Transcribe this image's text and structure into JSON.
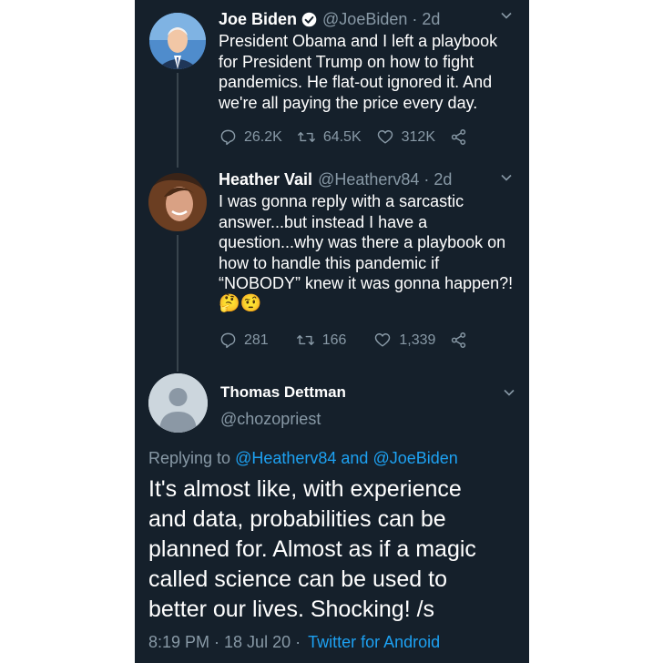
{
  "tweets": [
    {
      "name": "Joe Biden",
      "handle": "@JoeBiden",
      "time": "· 2d",
      "lines": [
        "President Obama and I left a playbook",
        "for President Trump on how to fight",
        "pandemics. He flat-out ignored it. And",
        "we're all paying the price every day."
      ],
      "replies": "26.2K",
      "retweets": "64.5K",
      "likes": "312K"
    },
    {
      "name": "Heather Vail",
      "handle": "@Heatherv84",
      "time": "· 2d",
      "lines": [
        "I was gonna reply with a sarcastic",
        "answer...but instead I have a",
        "question...why was there a playbook on",
        "how to handle this pandemic if",
        "“NOBODY” knew it was gonna happen?!"
      ],
      "emojis": [
        "🤔",
        "🤨"
      ],
      "replies": "281",
      "retweets": "166",
      "likes": "1,339"
    }
  ],
  "main_tweet": {
    "name": "Thomas Dettman",
    "handle": "@chozopriest",
    "replying_prefix": "Replying to",
    "replying_users": "@Heatherv84 and @JoeBiden",
    "lines": [
      "It's almost like, with experience",
      "and data, probabilities can be",
      "planned for. Almost as if a magic",
      "called science can be used to",
      "better our lives. Shocking! /s"
    ],
    "timestamp": "8:19 PM · 18 Jul 20 ·",
    "source": "Twitter for Android"
  },
  "colors": {
    "background": "#15202b",
    "text": "#ffffff",
    "secondary": "#8899a6",
    "accent": "#1da1f2"
  }
}
